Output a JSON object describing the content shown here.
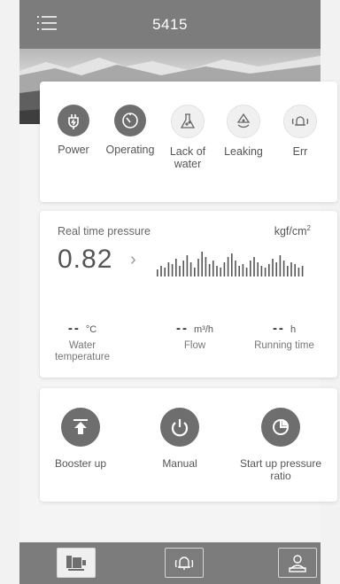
{
  "header": {
    "title": "5415",
    "menu_icon": "menu-icon"
  },
  "status": {
    "items": [
      {
        "label": "Power",
        "icon": "power-plug-icon",
        "active": true
      },
      {
        "label": "Operating",
        "icon": "operating-clock-icon",
        "active": true
      },
      {
        "label": "Lack of water",
        "icon": "flask-icon",
        "active": false
      },
      {
        "label": "Leaking",
        "icon": "leaking-drop-icon",
        "active": false
      },
      {
        "label": "Err",
        "icon": "alarm-bell-icon",
        "active": false
      }
    ]
  },
  "pressure": {
    "label": "Real time pressure",
    "unit_base": "kgf/cm",
    "unit_sup": "2",
    "value": "0.82",
    "arrow": "›"
  },
  "metrics": {
    "water_temp": {
      "value": "--",
      "unit": "°C",
      "name": "Water temperature"
    },
    "flow": {
      "value": "--",
      "unit": "m³/h",
      "name": "Flow"
    },
    "running_time": {
      "value": "--",
      "unit": "h",
      "name": "Running time"
    }
  },
  "actions": [
    {
      "label": "Booster up",
      "icon": "booster-up-icon"
    },
    {
      "label": "Manual",
      "icon": "power-button-icon"
    },
    {
      "label": "Start up pressure ratio",
      "icon": "pie-chart-icon"
    }
  ],
  "bottom_nav": [
    {
      "icon": "pump-icon",
      "active": true
    },
    {
      "icon": "bell-icon",
      "active": false
    },
    {
      "icon": "user-profile-icon",
      "active": false
    }
  ],
  "colors": {
    "header_bg": "#7c7c7c",
    "icon_fill": "#6e6e6e",
    "card_bg": "#ffffff"
  }
}
